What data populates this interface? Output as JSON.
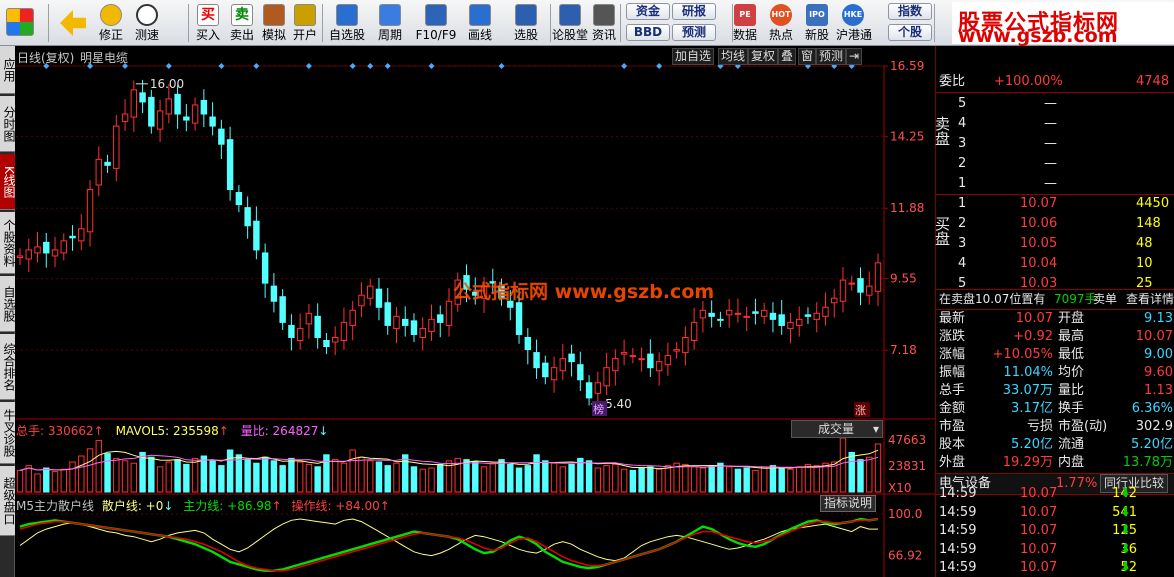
{
  "toolbar": {
    "buttons": [
      {
        "label": "",
        "icon": "grid-icon"
      },
      {
        "label": "",
        "icon": "back-arrow-icon"
      },
      {
        "label": "修正",
        "icon": "arrow-up-icon"
      },
      {
        "label": "测速",
        "icon": "clock-icon"
      },
      {
        "label": "买入",
        "icon": "buy-icon",
        "glyph": "买"
      },
      {
        "label": "卖出",
        "icon": "sell-icon",
        "glyph": "卖"
      },
      {
        "label": "模拟",
        "icon": "hammer-icon"
      },
      {
        "label": "开户",
        "icon": "lock-icon"
      },
      {
        "label": "自选股",
        "icon": "star-icon"
      },
      {
        "label": "周期",
        "icon": "period-icon"
      },
      {
        "label": "F10/F9",
        "icon": "f10-icon"
      },
      {
        "label": "画线",
        "icon": "pen-icon"
      },
      {
        "label": "选股",
        "icon": "select-icon"
      },
      {
        "label": "论股堂",
        "icon": "forum-icon"
      },
      {
        "label": "资讯",
        "icon": "camera-icon"
      }
    ],
    "pills": [
      "资金",
      "研报",
      "BBD",
      "预测"
    ],
    "buttons2": [
      {
        "label": "数据",
        "icon": "pe-icon",
        "glyph": "PE"
      },
      {
        "label": "热点",
        "icon": "hot-icon",
        "glyph": "HOT"
      },
      {
        "label": "新股",
        "icon": "ipo-icon",
        "glyph": "IPO"
      },
      {
        "label": "沪港通",
        "icon": "hk-icon",
        "glyph": "HKE"
      }
    ],
    "pills2": [
      "指数",
      "个股"
    ],
    "brand_line1": "股票公式指标网",
    "brand_line2": "www.gszb.com"
  },
  "left_tabs": [
    {
      "label": "应用",
      "active": false
    },
    {
      "label": "分时图",
      "active": false
    },
    {
      "label": "K线图",
      "active": true
    },
    {
      "label": "个股资料",
      "active": false
    },
    {
      "label": "自选股",
      "active": false
    },
    {
      "label": "综合排名",
      "active": false
    },
    {
      "label": "牛叉诊股",
      "active": false
    },
    {
      "label": "超级盘口",
      "active": false
    }
  ],
  "chart": {
    "title_left": "日线(复权)",
    "stock_name": "明星电缆",
    "header_buttons": [
      "加自选",
      "均线",
      "复权",
      "叠",
      "窗",
      "预测",
      "⇥"
    ],
    "price_axis": [
      "16.59",
      "14.25",
      "11.88",
      "9.55",
      "7.18"
    ],
    "high_label": "16.00",
    "low_label": "5.40",
    "bang_label": "榜",
    "zhang_label": "涨",
    "watermark": "公式指标网 www.gszb.com",
    "vol_header": {
      "total_label": "总手: 330662",
      "ma_label": "MAVOL5: 235598",
      "ratio_label": "量比: 264827"
    },
    "vol_dropdown": "成交量",
    "vol_axis": [
      "47663",
      "23831",
      "X10"
    ],
    "ind_header": {
      "name": "M5主力散户线",
      "retail": "散户线: +0",
      "main": "主力线: +86.98",
      "op": "操作线: +84.00"
    },
    "ind_button": "指标说明",
    "ind_axis": [
      "100.0",
      "66.92"
    ],
    "colors": {
      "up": "#ff3030",
      "down": "#54ffff",
      "retail": "#ffff80",
      "main": "#00e000",
      "op": "#e00000"
    }
  },
  "chart_data": {
    "type": "candlestick",
    "ylim": [
      5.0,
      16.59
    ],
    "price_levels": [
      16.59,
      14.25,
      11.88,
      9.55,
      7.18
    ],
    "high": 16.0,
    "low": 5.4,
    "closes": [
      10.3,
      10.5,
      10.6,
      10.4,
      10.5,
      10.8,
      10.9,
      11.2,
      12.5,
      13.5,
      13.3,
      14.6,
      15.0,
      15.8,
      15.4,
      14.6,
      15.1,
      15.5,
      15.0,
      14.8,
      15.3,
      15.0,
      14.6,
      14.0,
      12.5,
      12.0,
      11.3,
      10.5,
      9.4,
      8.8,
      8.1,
      7.6,
      7.9,
      8.4,
      7.6,
      7.3,
      7.6,
      8.1,
      8.5,
      9.0,
      9.3,
      8.6,
      8.0,
      8.3,
      8.0,
      7.7,
      7.9,
      8.2,
      8.1,
      8.8,
      9.5,
      9.2,
      9.0,
      9.3,
      9.4,
      8.9,
      8.6,
      7.7,
      7.2,
      6.6,
      6.3,
      6.6,
      6.9,
      6.8,
      6.2,
      5.6,
      6.1,
      6.6,
      6.9,
      7.1,
      7.0,
      6.9,
      6.6,
      6.8,
      7.0,
      7.2,
      7.6,
      8.1,
      8.5,
      8.3,
      8.2,
      8.5,
      8.4,
      8.3,
      8.4,
      8.5,
      8.2,
      8.0,
      8.1,
      8.2,
      8.3,
      8.4,
      8.6,
      8.9,
      9.5,
      9.4,
      9.1,
      9.3,
      10.07
    ],
    "volume_values": [
      18,
      22,
      15,
      20,
      17,
      19,
      25,
      30,
      36,
      43,
      32,
      28,
      26,
      24,
      33,
      29,
      21,
      25,
      27,
      23,
      28,
      30,
      26,
      22,
      35,
      31,
      27,
      24,
      29,
      26,
      22,
      28,
      25,
      23,
      21,
      31,
      27,
      24,
      35,
      29,
      26,
      25,
      22,
      24,
      31,
      21,
      19,
      20,
      23,
      26,
      28,
      27,
      25,
      21,
      24,
      27,
      23,
      20,
      22,
      31,
      26,
      24,
      21,
      23,
      28,
      26,
      20,
      22,
      23,
      19,
      18,
      20,
      21,
      19,
      22,
      24,
      23,
      21,
      20,
      22,
      24,
      21,
      19,
      20,
      18,
      21,
      22,
      20,
      19,
      21,
      23,
      22,
      24,
      25,
      45,
      33,
      27,
      29,
      40
    ],
    "indicator": {
      "retail": [
        75,
        80,
        85,
        88,
        90,
        92,
        93,
        92,
        90,
        88,
        86,
        85,
        83,
        82,
        80,
        78,
        80,
        83,
        85,
        86,
        87,
        85,
        80,
        76,
        72,
        70,
        73,
        78,
        83,
        88,
        92,
        95,
        96,
        95,
        94,
        93,
        92,
        95,
        96,
        94,
        90,
        86,
        82,
        78,
        74,
        70,
        68,
        67,
        69,
        72,
        76,
        80,
        83,
        82,
        80,
        78,
        75,
        72,
        70,
        69,
        72,
        76,
        78,
        76,
        72,
        69,
        66,
        64,
        63,
        65,
        70,
        75,
        78,
        80,
        82,
        83,
        82,
        80,
        78,
        76,
        74,
        72,
        73,
        75,
        78,
        80,
        83,
        86,
        88,
        89,
        90,
        91,
        92,
        90,
        88,
        86,
        90,
        88,
        88
      ],
      "main": [
        90,
        92,
        93,
        94,
        95,
        94,
        93,
        92,
        91,
        90,
        89,
        88,
        87,
        86,
        85,
        84,
        83,
        82,
        80,
        78,
        76,
        73,
        70,
        66,
        62,
        60,
        58,
        56,
        55,
        55,
        56,
        58,
        60,
        62,
        64,
        66,
        68,
        70,
        72,
        74,
        76,
        78,
        80,
        82,
        84,
        86,
        85,
        84,
        83,
        82,
        80,
        76,
        72,
        69,
        70,
        74,
        79,
        82,
        80,
        76,
        70,
        66,
        62,
        60,
        58,
        57,
        58,
        60,
        62,
        64,
        66,
        68,
        70,
        72,
        75,
        78,
        82,
        86,
        90,
        88,
        84,
        80,
        77,
        75,
        74,
        76,
        80,
        84,
        88,
        91,
        94,
        95,
        93,
        92,
        93,
        94,
        96,
        95,
        96
      ],
      "op": [
        88,
        90,
        92,
        93,
        94,
        94,
        93,
        92,
        91,
        90,
        89,
        88,
        87,
        86,
        85,
        84,
        83,
        82,
        81,
        80,
        78,
        76,
        73,
        70,
        66,
        62,
        59,
        57,
        56,
        55,
        55,
        56,
        58,
        60,
        62,
        64,
        66,
        68,
        70,
        72,
        74,
        76,
        78,
        80,
        82,
        84,
        85,
        84,
        83,
        82,
        81,
        79,
        76,
        73,
        71,
        73,
        77,
        80,
        81,
        78,
        74,
        70,
        66,
        63,
        61,
        59,
        59,
        60,
        62,
        64,
        66,
        68,
        70,
        72,
        75,
        78,
        81,
        84,
        86,
        86,
        84,
        82,
        80,
        78,
        77,
        78,
        80,
        83,
        86,
        89,
        92,
        94,
        94,
        93,
        93,
        94,
        95,
        95,
        96
      ]
    }
  },
  "rpanel": {
    "header_label": "委比",
    "header_value": "+100.00%",
    "header_right": "4748",
    "sell_side_label": "卖盘",
    "sell_rows": [
      {
        "n": "5",
        "price": "—",
        "vol": ""
      },
      {
        "n": "4",
        "price": "—",
        "vol": ""
      },
      {
        "n": "3",
        "price": "—",
        "vol": ""
      },
      {
        "n": "2",
        "price": "—",
        "vol": ""
      },
      {
        "n": "1",
        "price": "—",
        "vol": ""
      }
    ],
    "buy_side_label": "买盘",
    "buy_rows": [
      {
        "n": "1",
        "price": "10.07",
        "vol": "4450"
      },
      {
        "n": "2",
        "price": "10.06",
        "vol": "148"
      },
      {
        "n": "3",
        "price": "10.05",
        "vol": "48"
      },
      {
        "n": "4",
        "price": "10.04",
        "vol": "10"
      },
      {
        "n": "5",
        "price": "10.03",
        "vol": "25"
      }
    ],
    "status": {
      "left": "在卖盘10.07位置有",
      "mid": "7097手",
      "r1": "卖单",
      "r2": "查看详情"
    },
    "quote": [
      {
        "l": "最新",
        "lv": "10.07",
        "r": "开盘",
        "rv": "9.13",
        "lc": "red",
        "rc": "cy"
      },
      {
        "l": "涨跌",
        "lv": "+0.92",
        "r": "最高",
        "rv": "10.07",
        "lc": "red",
        "rc": "red"
      },
      {
        "l": "涨幅",
        "lv": "+10.05%",
        "r": "最低",
        "rv": "9.00",
        "lc": "red",
        "rc": "cy"
      },
      {
        "l": "振幅",
        "lv": "11.04%",
        "r": "均价",
        "rv": "9.60",
        "lc": "cy",
        "rc": "red"
      },
      {
        "l": "总手",
        "lv": "33.07万",
        "r": "量比",
        "rv": "1.13",
        "lc": "cy",
        "rc": "red"
      },
      {
        "l": "金额",
        "lv": "3.17亿",
        "r": "换手",
        "rv": "6.36%",
        "lc": "cy",
        "rc": "cy"
      },
      {
        "l": "市盈",
        "lv": "亏损",
        "r": "市盈(动)",
        "rv": "302.9",
        "lc": "wh",
        "rc": "wh"
      },
      {
        "l": "股本",
        "lv": "5.20亿",
        "r": "流通",
        "rv": "5.20亿",
        "lc": "cy",
        "rc": "cy"
      },
      {
        "l": "外盘",
        "lv": "19.29万",
        "r": "内盘",
        "rv": "13.78万",
        "lc": "red",
        "rc": "grn"
      }
    ],
    "sector": {
      "name": "电气设备",
      "pct": "1.77%",
      "btn": "同行业比较"
    },
    "ticks": [
      {
        "time": "14:59",
        "price": "10.07",
        "vol": "142"
      },
      {
        "time": "14:59",
        "price": "10.07",
        "vol": "541"
      },
      {
        "time": "14:59",
        "price": "10.07",
        "vol": "125"
      },
      {
        "time": "14:59",
        "price": "10.07",
        "vol": "36"
      },
      {
        "time": "14:59",
        "price": "10.07",
        "vol": "52"
      }
    ]
  }
}
